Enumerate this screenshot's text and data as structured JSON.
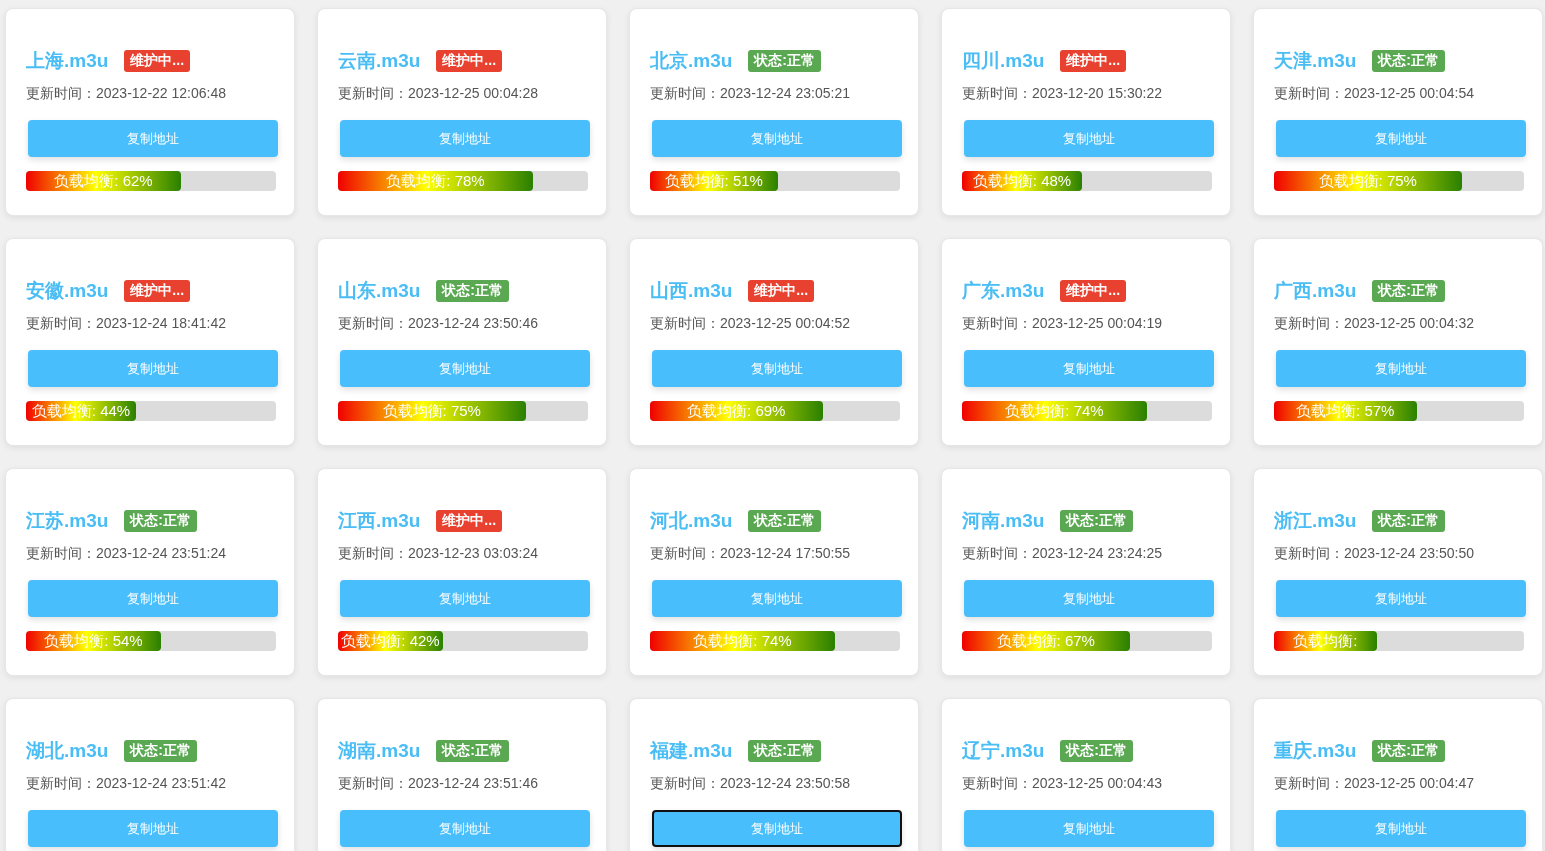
{
  "cards": [
    {
      "title": "上海.m3u",
      "status": {
        "kind": "maintenance",
        "label": "维护中..."
      },
      "updated": "更新时间：2023-12-22 12:06:48",
      "button": "复制地址",
      "focused": false,
      "load": {
        "label": "负载均衡: 62%",
        "level": 0.62
      }
    },
    {
      "title": "云南.m3u",
      "status": {
        "kind": "maintenance",
        "label": "维护中..."
      },
      "updated": "更新时间：2023-12-25 00:04:28",
      "button": "复制地址",
      "focused": false,
      "load": {
        "label": "负载均衡: 78%",
        "level": 0.78
      }
    },
    {
      "title": "北京.m3u",
      "status": {
        "kind": "normal",
        "label": "状态:正常"
      },
      "updated": "更新时间：2023-12-24 23:05:21",
      "button": "复制地址",
      "focused": false,
      "load": {
        "label": "负载均衡: 51%",
        "level": 0.51
      }
    },
    {
      "title": "四川.m3u",
      "status": {
        "kind": "maintenance",
        "label": "维护中..."
      },
      "updated": "更新时间：2023-12-20 15:30:22",
      "button": "复制地址",
      "focused": false,
      "load": {
        "label": "负载均衡: 48%",
        "level": 0.48
      }
    },
    {
      "title": "天津.m3u",
      "status": {
        "kind": "normal",
        "label": "状态:正常"
      },
      "updated": "更新时间：2023-12-25 00:04:54",
      "button": "复制地址",
      "focused": false,
      "load": {
        "label": "负载均衡: 75%",
        "level": 0.75
      }
    },
    {
      "title": "安徽.m3u",
      "status": {
        "kind": "maintenance",
        "label": "维护中..."
      },
      "updated": "更新时间：2023-12-24 18:41:42",
      "button": "复制地址",
      "focused": false,
      "load": {
        "label": "负载均衡: 44%",
        "level": 0.44
      }
    },
    {
      "title": "山东.m3u",
      "status": {
        "kind": "normal",
        "label": "状态:正常"
      },
      "updated": "更新时间：2023-12-24 23:50:46",
      "button": "复制地址",
      "focused": false,
      "load": {
        "label": "负载均衡: 75%",
        "level": 0.75
      }
    },
    {
      "title": "山西.m3u",
      "status": {
        "kind": "maintenance",
        "label": "维护中..."
      },
      "updated": "更新时间：2023-12-25 00:04:52",
      "button": "复制地址",
      "focused": false,
      "load": {
        "label": "负载均衡: 69%",
        "level": 0.69
      }
    },
    {
      "title": "广东.m3u",
      "status": {
        "kind": "maintenance",
        "label": "维护中..."
      },
      "updated": "更新时间：2023-12-25 00:04:19",
      "button": "复制地址",
      "focused": false,
      "load": {
        "label": "负载均衡: 74%",
        "level": 0.74
      }
    },
    {
      "title": "广西.m3u",
      "status": {
        "kind": "normal",
        "label": "状态:正常"
      },
      "updated": "更新时间：2023-12-25 00:04:32",
      "button": "复制地址",
      "focused": false,
      "load": {
        "label": "负载均衡: 57%",
        "level": 0.57
      }
    },
    {
      "title": "江苏.m3u",
      "status": {
        "kind": "normal",
        "label": "状态:正常"
      },
      "updated": "更新时间：2023-12-24 23:51:24",
      "button": "复制地址",
      "focused": false,
      "load": {
        "label": "负载均衡: 54%",
        "level": 0.54
      }
    },
    {
      "title": "江西.m3u",
      "status": {
        "kind": "maintenance",
        "label": "维护中..."
      },
      "updated": "更新时间：2023-12-23 03:03:24",
      "button": "复制地址",
      "focused": false,
      "load": {
        "label": "负载均衡: 42%",
        "level": 0.42
      }
    },
    {
      "title": "河北.m3u",
      "status": {
        "kind": "normal",
        "label": "状态:正常"
      },
      "updated": "更新时间：2023-12-24 17:50:55",
      "button": "复制地址",
      "focused": false,
      "load": {
        "label": "负载均衡: 74%",
        "level": 0.74
      }
    },
    {
      "title": "河南.m3u",
      "status": {
        "kind": "normal",
        "label": "状态:正常"
      },
      "updated": "更新时间：2023-12-24 23:24:25",
      "button": "复制地址",
      "focused": false,
      "load": {
        "label": "负载均衡: 67%",
        "level": 0.67
      }
    },
    {
      "title": "浙江.m3u",
      "status": {
        "kind": "normal",
        "label": "状态:正常"
      },
      "updated": "更新时间：2023-12-24 23:50:50",
      "button": "复制地址",
      "focused": false,
      "load": {
        "label": "负载均衡:",
        "level": 0.41
      }
    },
    {
      "title": "湖北.m3u",
      "status": {
        "kind": "normal",
        "label": "状态:正常"
      },
      "updated": "更新时间：2023-12-24 23:51:42",
      "button": "复制地址",
      "focused": false
    },
    {
      "title": "湖南.m3u",
      "status": {
        "kind": "normal",
        "label": "状态:正常"
      },
      "updated": "更新时间：2023-12-24 23:51:46",
      "button": "复制地址",
      "focused": false
    },
    {
      "title": "福建.m3u",
      "status": {
        "kind": "normal",
        "label": "状态:正常"
      },
      "updated": "更新时间：2023-12-24 23:50:58",
      "button": "复制地址",
      "focused": true
    },
    {
      "title": "辽宁.m3u",
      "status": {
        "kind": "normal",
        "label": "状态:正常"
      },
      "updated": "更新时间：2023-12-25 00:04:43",
      "button": "复制地址",
      "focused": false
    },
    {
      "title": "重庆.m3u",
      "status": {
        "kind": "normal",
        "label": "状态:正常"
      },
      "updated": "更新时间：2023-12-25 00:04:47",
      "button": "复制地址",
      "focused": false
    }
  ]
}
